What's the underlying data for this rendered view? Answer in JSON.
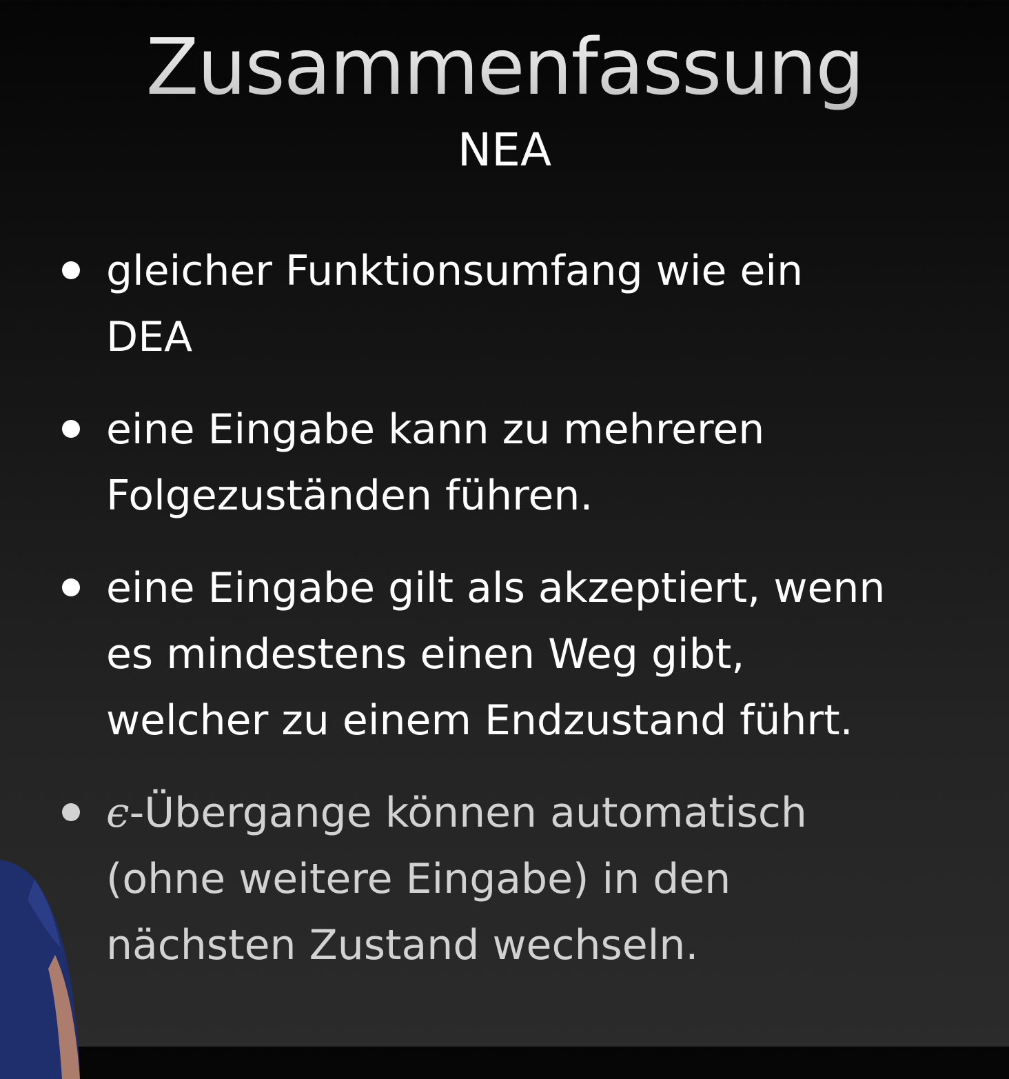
{
  "slide": {
    "title": "Zusammenfassung",
    "subtitle": "NEA",
    "bullets": [
      {
        "lines": [
          "gleicher Funktionsumfang wie ein",
          "DEA"
        ]
      },
      {
        "lines": [
          "eine Eingabe kann zu mehreren",
          "Folgezuständen führen."
        ]
      },
      {
        "lines": [
          "eine Eingabe gilt als akzeptiert, wenn",
          "es mindestens einen Weg gibt,",
          "welcher zu einem Endzustand führt."
        ]
      },
      {
        "epsilon": "ϵ",
        "first_line_rest": "-Übergange können automatisch",
        "lines": [
          "(ohne weitere Eingabe) in den",
          "nächsten Zustand wechseln."
        ]
      }
    ]
  },
  "colors": {
    "background_top": "#050505",
    "background_bottom": "#2b2b2b",
    "text": "#ffffff",
    "presenter_shirt": "#1f2f6e"
  }
}
